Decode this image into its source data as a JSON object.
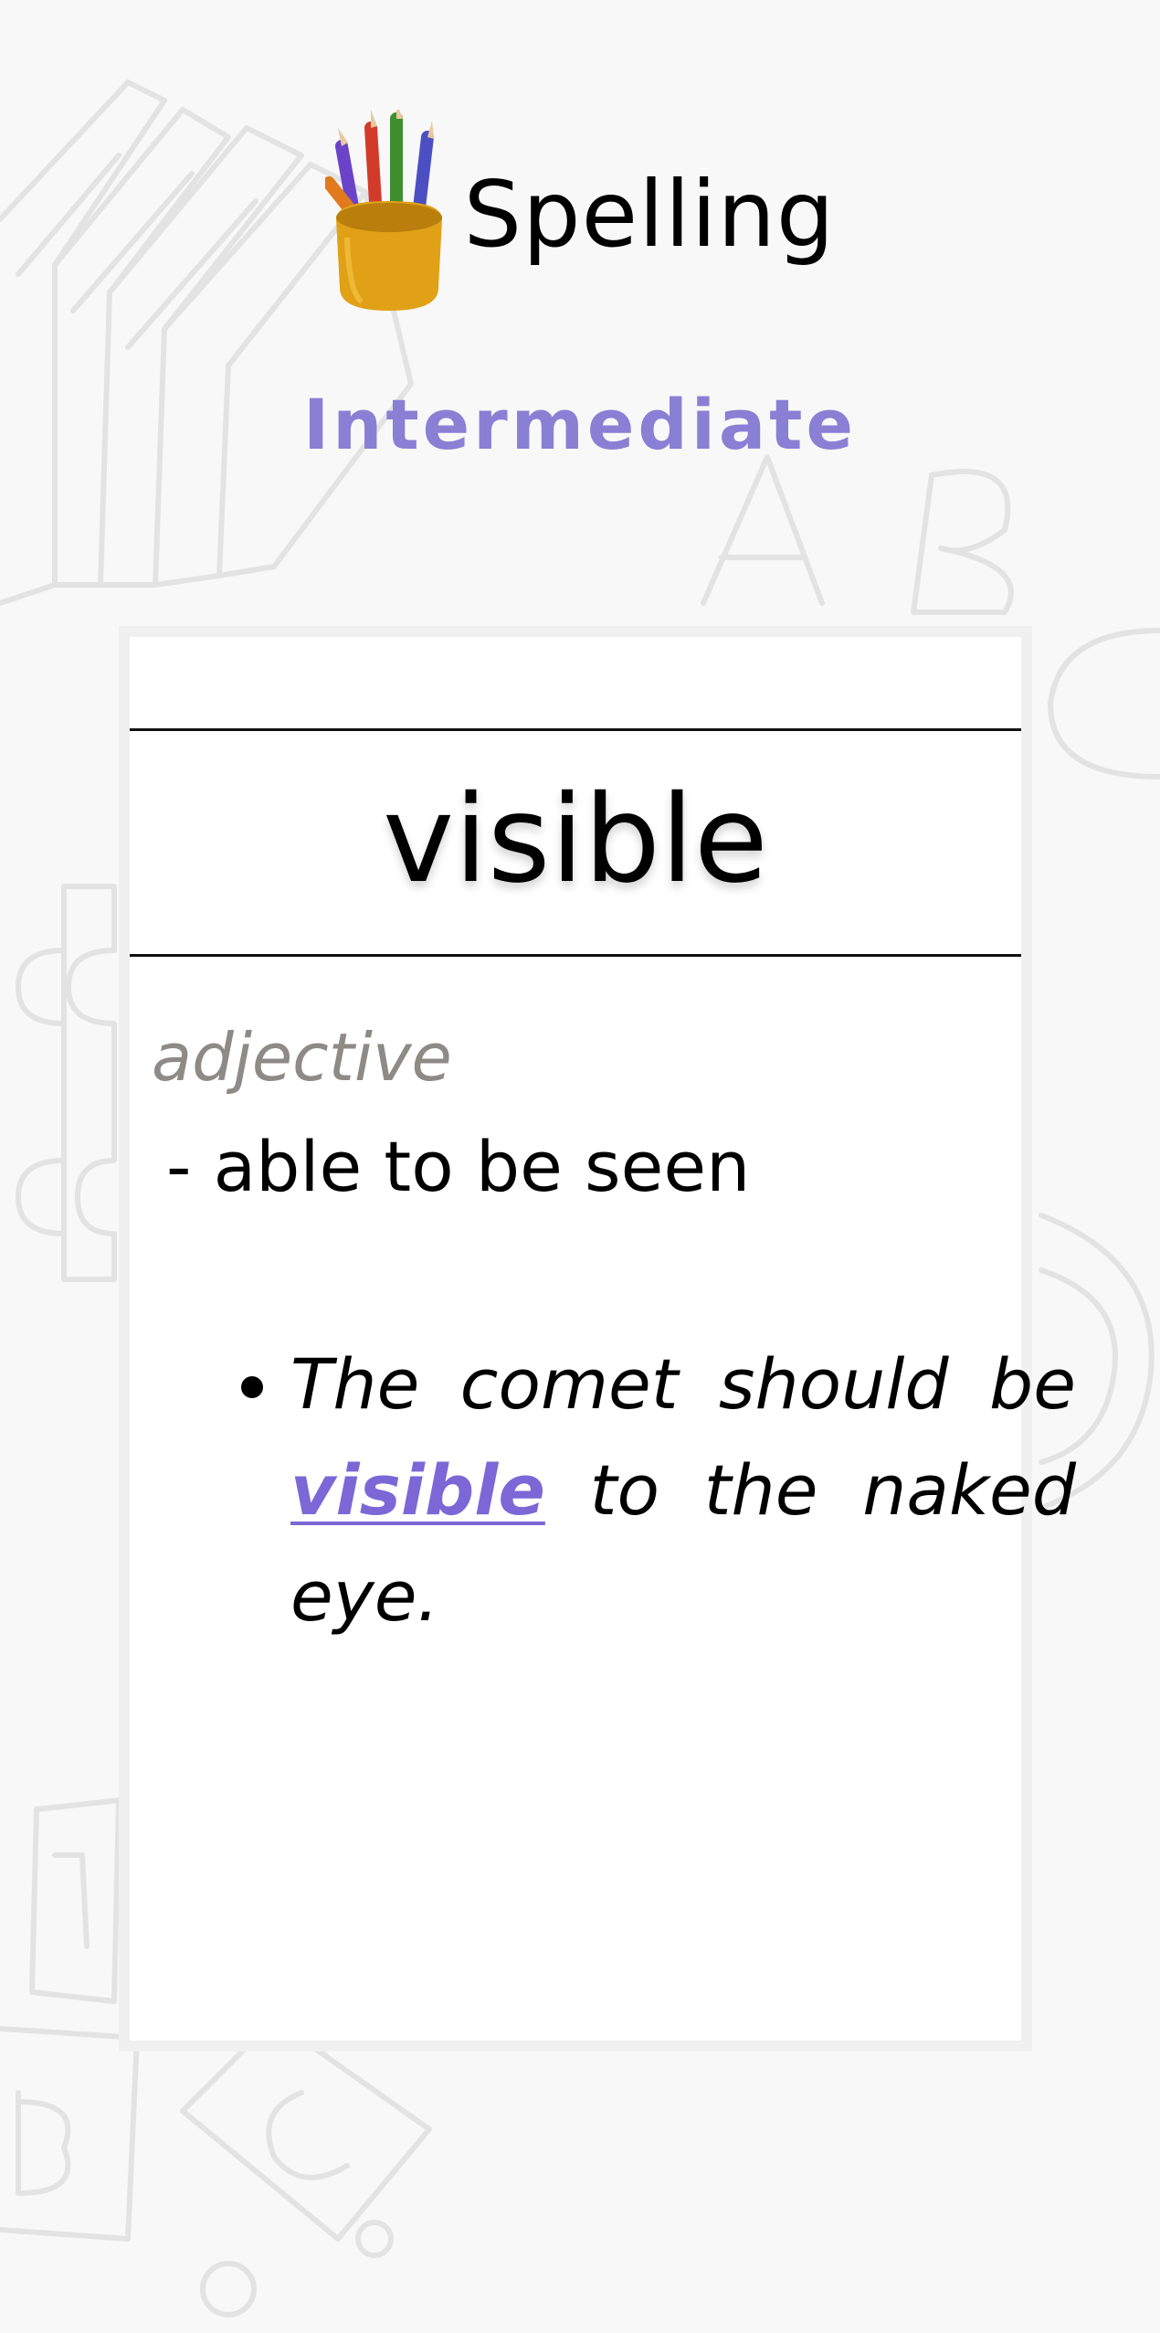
{
  "app": {
    "title": "Spelling",
    "level": "Intermediate",
    "logo_icon": "pencil-cup-icon"
  },
  "card": {
    "word": "visible",
    "part_of_speech": "adjective",
    "definition": "- able to be seen",
    "example": {
      "before": "The comet should be ",
      "highlight": "visible",
      "after": " to the naked eye."
    }
  },
  "colors": {
    "accent": "#8a7fd4",
    "highlight": "#7b68d6",
    "pos_gray": "#8e8a86",
    "background": "#f8f8f8",
    "card_border": "#f0f0f0"
  }
}
